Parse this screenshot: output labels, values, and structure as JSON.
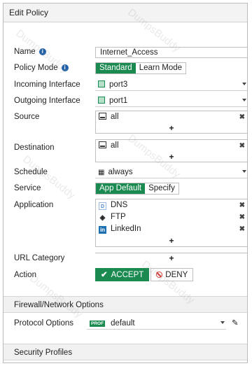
{
  "panel": {
    "title": "Edit Policy"
  },
  "name": {
    "label": "Name",
    "value": "Internet_Access"
  },
  "policy_mode": {
    "label": "Policy Mode",
    "options": [
      "Standard",
      "Learn Mode"
    ],
    "selected": "Standard"
  },
  "incoming": {
    "label": "Incoming Interface",
    "value": "port3"
  },
  "outgoing": {
    "label": "Outgoing Interface",
    "value": "port1"
  },
  "source": {
    "label": "Source",
    "items": [
      "all"
    ],
    "add": "+"
  },
  "destination": {
    "label": "Destination",
    "items": [
      "all"
    ],
    "add": "+"
  },
  "schedule": {
    "label": "Schedule",
    "value": "always"
  },
  "service": {
    "label": "Service",
    "options": [
      "App Default",
      "Specify"
    ],
    "selected": "App Default"
  },
  "application": {
    "label": "Application",
    "items": [
      "DNS",
      "FTP",
      "LinkedIn"
    ],
    "add": "+"
  },
  "url_category": {
    "label": "URL Category",
    "add": "+"
  },
  "action": {
    "label": "Action",
    "accept": "ACCEPT",
    "deny": "DENY",
    "selected": "ACCEPT"
  },
  "firewall_options": {
    "title": "Firewall/Network Options",
    "protocol_label": "Protocol Options",
    "protocol_badge": "PROF",
    "protocol_value": "default"
  },
  "security_profiles": {
    "title": "Security Profiles"
  },
  "watermark": "DumpsBuddy",
  "colors": {
    "accent": "#1b8a50",
    "info": "#1e5fa8",
    "deny": "#d23a3a"
  }
}
